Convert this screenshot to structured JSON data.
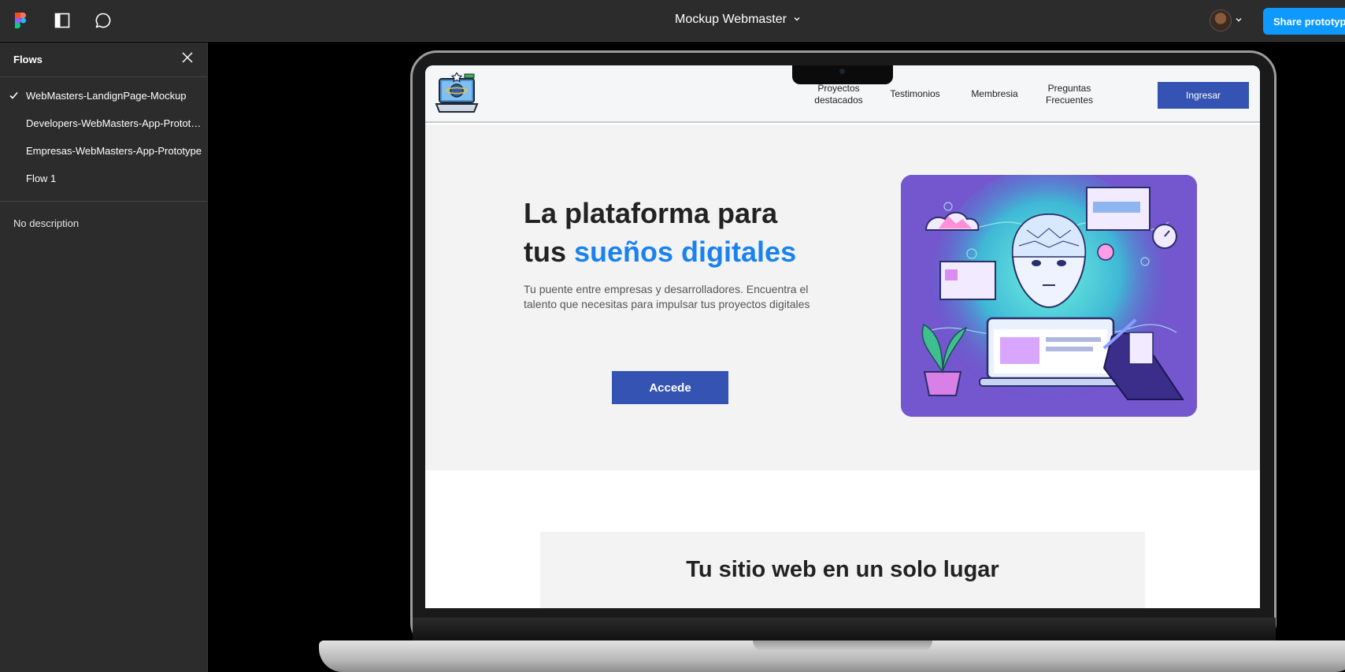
{
  "topbar": {
    "doc_title": "Mockup Webmaster",
    "share_label": "Share prototype",
    "icons": [
      "figma-logo-icon",
      "panel-toggle-icon",
      "comment-icon",
      "chevron-down-icon"
    ]
  },
  "sidebar": {
    "title": "Flows",
    "flows": [
      {
        "label": "WebMasters-LandignPage-Mockup",
        "selected": true
      },
      {
        "label": "Developers-WebMasters-App-Prototype",
        "selected": false
      },
      {
        "label": "Empresas-WebMasters-App-Prototype",
        "selected": false
      },
      {
        "label": "Flow 1",
        "selected": false
      }
    ],
    "description": "No description"
  },
  "site": {
    "nav": {
      "links": [
        "Proyectos destacados",
        "Testimonios",
        "Membresia",
        "Preguntas Frecuentes"
      ],
      "login_label": "Ingresar"
    },
    "hero": {
      "title_line1": "La plataforma para",
      "title_line2_plain": "tus ",
      "title_line2_accent": "sueños digitales",
      "subtitle": "Tu puente entre empresas y desarrolladores. Encuentra el talento que necesitas para impulsar tus proyectos digitales",
      "cta_label": "Accede"
    },
    "section": {
      "title": "Tu sitio web en un solo lugar"
    }
  },
  "colors": {
    "accent_blue": "#1a82f0",
    "button_blue": "#3553b2",
    "figma_blue": "#0d99ff",
    "panel_bg": "#2c2c2c"
  }
}
